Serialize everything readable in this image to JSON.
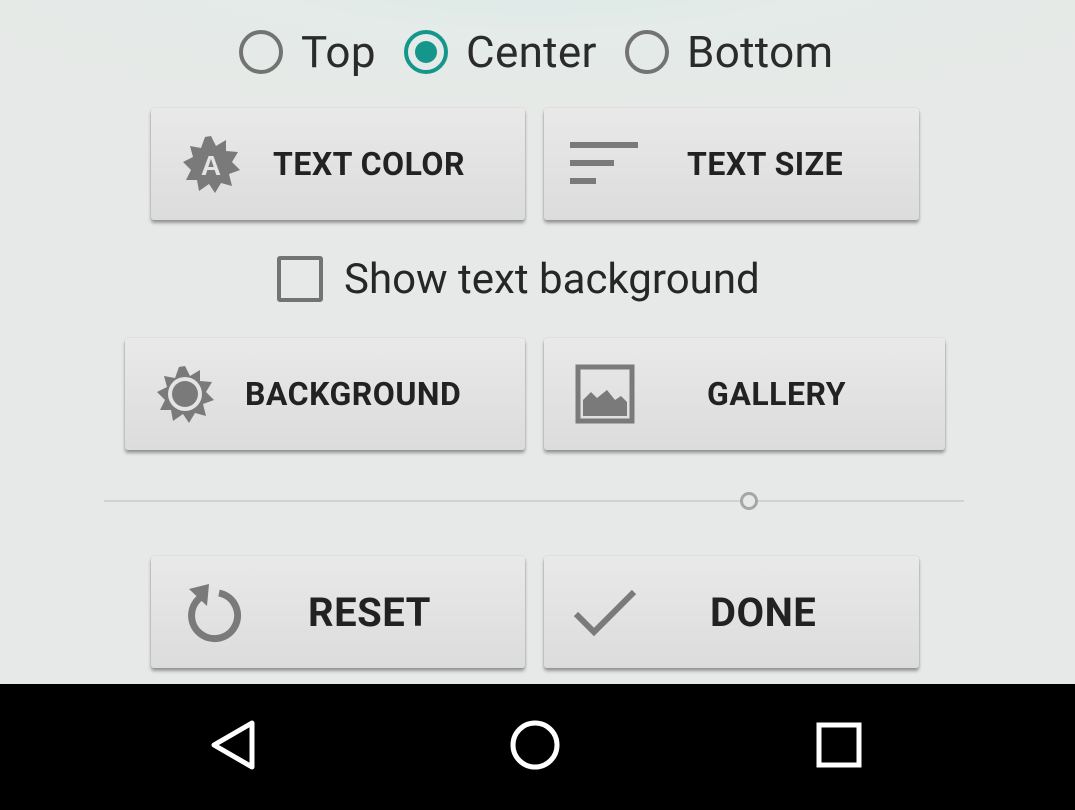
{
  "position_options": [
    {
      "label": "Top",
      "checked": false
    },
    {
      "label": "Center",
      "checked": true
    },
    {
      "label": "Bottom",
      "checked": false
    }
  ],
  "buttons": {
    "text_color": "TEXT COLOR",
    "text_size": "TEXT SIZE",
    "background": "BACKGROUND",
    "gallery": "GALLERY",
    "reset": "RESET",
    "done": "DONE"
  },
  "show_text_background": {
    "label": "Show text background",
    "checked": false
  },
  "slider": {
    "value_fraction": 0.75
  },
  "colors": {
    "accent": "#15968a",
    "button_bg": "#e2e2e2",
    "navbar_bg": "#000000"
  },
  "icons": {
    "text_color": "text-color-badge-icon",
    "text_size": "text-size-lines-icon",
    "background": "background-sun-icon",
    "gallery": "gallery-image-icon",
    "reset": "reset-rotate-icon",
    "done": "done-check-icon",
    "nav_back": "back-triangle-icon",
    "nav_home": "home-circle-icon",
    "nav_recents": "recents-square-icon"
  }
}
